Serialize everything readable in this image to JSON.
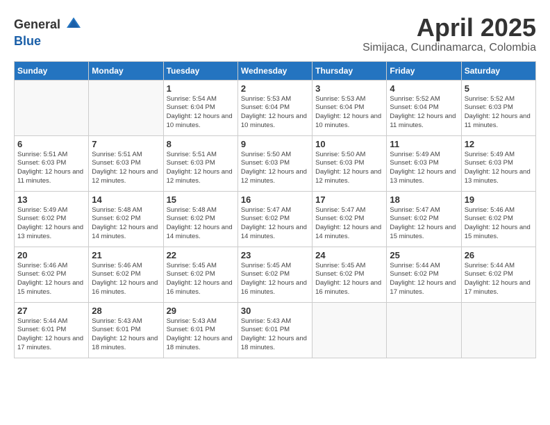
{
  "header": {
    "logo_general": "General",
    "logo_blue": "Blue",
    "month_title": "April 2025",
    "location": "Simijaca, Cundinamarca, Colombia"
  },
  "weekdays": [
    "Sunday",
    "Monday",
    "Tuesday",
    "Wednesday",
    "Thursday",
    "Friday",
    "Saturday"
  ],
  "weeks": [
    [
      {
        "day": "",
        "sunrise": "",
        "sunset": "",
        "daylight": ""
      },
      {
        "day": "",
        "sunrise": "",
        "sunset": "",
        "daylight": ""
      },
      {
        "day": "1",
        "sunrise": "5:54 AM",
        "sunset": "6:04 PM",
        "daylight": "12 hours and 10 minutes."
      },
      {
        "day": "2",
        "sunrise": "5:53 AM",
        "sunset": "6:04 PM",
        "daylight": "12 hours and 10 minutes."
      },
      {
        "day": "3",
        "sunrise": "5:53 AM",
        "sunset": "6:04 PM",
        "daylight": "12 hours and 10 minutes."
      },
      {
        "day": "4",
        "sunrise": "5:52 AM",
        "sunset": "6:04 PM",
        "daylight": "12 hours and 11 minutes."
      },
      {
        "day": "5",
        "sunrise": "5:52 AM",
        "sunset": "6:03 PM",
        "daylight": "12 hours and 11 minutes."
      }
    ],
    [
      {
        "day": "6",
        "sunrise": "5:51 AM",
        "sunset": "6:03 PM",
        "daylight": "12 hours and 11 minutes."
      },
      {
        "day": "7",
        "sunrise": "5:51 AM",
        "sunset": "6:03 PM",
        "daylight": "12 hours and 12 minutes."
      },
      {
        "day": "8",
        "sunrise": "5:51 AM",
        "sunset": "6:03 PM",
        "daylight": "12 hours and 12 minutes."
      },
      {
        "day": "9",
        "sunrise": "5:50 AM",
        "sunset": "6:03 PM",
        "daylight": "12 hours and 12 minutes."
      },
      {
        "day": "10",
        "sunrise": "5:50 AM",
        "sunset": "6:03 PM",
        "daylight": "12 hours and 12 minutes."
      },
      {
        "day": "11",
        "sunrise": "5:49 AM",
        "sunset": "6:03 PM",
        "daylight": "12 hours and 13 minutes."
      },
      {
        "day": "12",
        "sunrise": "5:49 AM",
        "sunset": "6:03 PM",
        "daylight": "12 hours and 13 minutes."
      }
    ],
    [
      {
        "day": "13",
        "sunrise": "5:49 AM",
        "sunset": "6:02 PM",
        "daylight": "12 hours and 13 minutes."
      },
      {
        "day": "14",
        "sunrise": "5:48 AM",
        "sunset": "6:02 PM",
        "daylight": "12 hours and 14 minutes."
      },
      {
        "day": "15",
        "sunrise": "5:48 AM",
        "sunset": "6:02 PM",
        "daylight": "12 hours and 14 minutes."
      },
      {
        "day": "16",
        "sunrise": "5:47 AM",
        "sunset": "6:02 PM",
        "daylight": "12 hours and 14 minutes."
      },
      {
        "day": "17",
        "sunrise": "5:47 AM",
        "sunset": "6:02 PM",
        "daylight": "12 hours and 14 minutes."
      },
      {
        "day": "18",
        "sunrise": "5:47 AM",
        "sunset": "6:02 PM",
        "daylight": "12 hours and 15 minutes."
      },
      {
        "day": "19",
        "sunrise": "5:46 AM",
        "sunset": "6:02 PM",
        "daylight": "12 hours and 15 minutes."
      }
    ],
    [
      {
        "day": "20",
        "sunrise": "5:46 AM",
        "sunset": "6:02 PM",
        "daylight": "12 hours and 15 minutes."
      },
      {
        "day": "21",
        "sunrise": "5:46 AM",
        "sunset": "6:02 PM",
        "daylight": "12 hours and 16 minutes."
      },
      {
        "day": "22",
        "sunrise": "5:45 AM",
        "sunset": "6:02 PM",
        "daylight": "12 hours and 16 minutes."
      },
      {
        "day": "23",
        "sunrise": "5:45 AM",
        "sunset": "6:02 PM",
        "daylight": "12 hours and 16 minutes."
      },
      {
        "day": "24",
        "sunrise": "5:45 AM",
        "sunset": "6:02 PM",
        "daylight": "12 hours and 16 minutes."
      },
      {
        "day": "25",
        "sunrise": "5:44 AM",
        "sunset": "6:02 PM",
        "daylight": "12 hours and 17 minutes."
      },
      {
        "day": "26",
        "sunrise": "5:44 AM",
        "sunset": "6:02 PM",
        "daylight": "12 hours and 17 minutes."
      }
    ],
    [
      {
        "day": "27",
        "sunrise": "5:44 AM",
        "sunset": "6:01 PM",
        "daylight": "12 hours and 17 minutes."
      },
      {
        "day": "28",
        "sunrise": "5:43 AM",
        "sunset": "6:01 PM",
        "daylight": "12 hours and 18 minutes."
      },
      {
        "day": "29",
        "sunrise": "5:43 AM",
        "sunset": "6:01 PM",
        "daylight": "12 hours and 18 minutes."
      },
      {
        "day": "30",
        "sunrise": "5:43 AM",
        "sunset": "6:01 PM",
        "daylight": "12 hours and 18 minutes."
      },
      {
        "day": "",
        "sunrise": "",
        "sunset": "",
        "daylight": ""
      },
      {
        "day": "",
        "sunrise": "",
        "sunset": "",
        "daylight": ""
      },
      {
        "day": "",
        "sunrise": "",
        "sunset": "",
        "daylight": ""
      }
    ]
  ]
}
